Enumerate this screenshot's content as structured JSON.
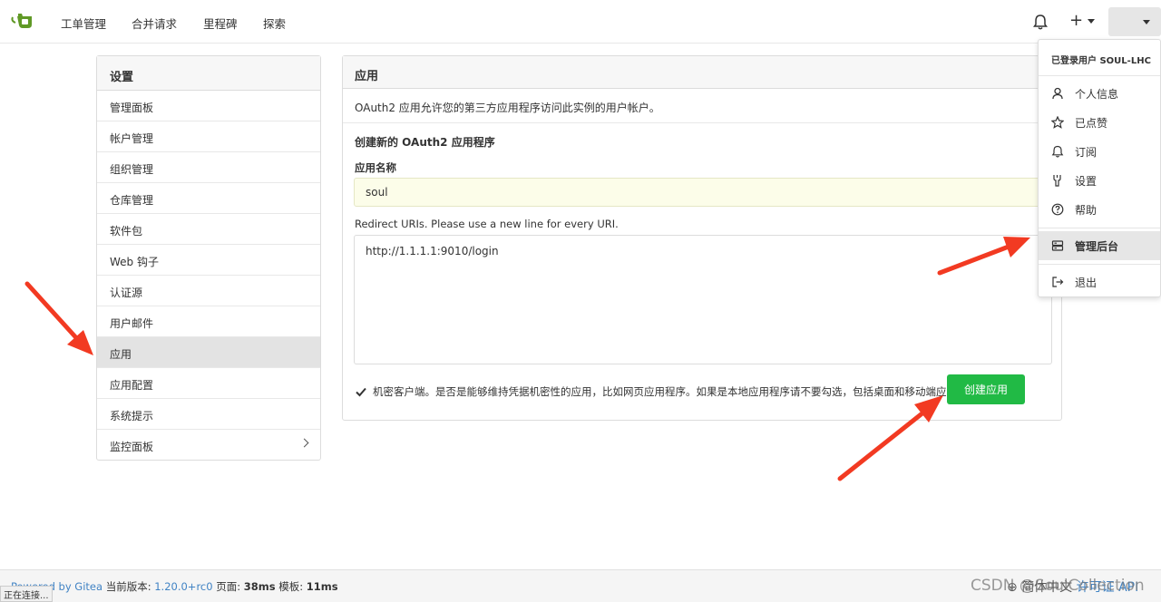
{
  "nav": {
    "items": [
      {
        "label": "工单管理"
      },
      {
        "label": "合并请求"
      },
      {
        "label": "里程碑"
      },
      {
        "label": "探索"
      }
    ]
  },
  "sidebar": {
    "title": "设置",
    "items": [
      {
        "label": "管理面板"
      },
      {
        "label": "帐户管理"
      },
      {
        "label": "组织管理"
      },
      {
        "label": "仓库管理"
      },
      {
        "label": "软件包"
      },
      {
        "label": "Web 钩子"
      },
      {
        "label": "认证源"
      },
      {
        "label": "用户邮件"
      },
      {
        "label": "应用"
      },
      {
        "label": "应用配置"
      },
      {
        "label": "系统提示"
      },
      {
        "label": "监控面板"
      }
    ],
    "active_index": 8
  },
  "panel": {
    "title": "应用",
    "description": "OAuth2 应用允许您的第三方应用程序访问此实例的用户帐户。",
    "section_title": "创建新的 OAuth2 应用程序",
    "name_label": "应用名称",
    "name_value": "soul",
    "uri_label": "Redirect URIs. Please use a new line for every URI.",
    "uri_value": "http://1.1.1.1:9010/login",
    "confidential_label": "机密客户端。是否是能够维持凭据机密性的应用，比如网页应用程序。如果是本地应用程序请不要勾选，包括桌面和移动端应用。",
    "create_button": "创建应用"
  },
  "dropdown": {
    "header": "已登录用户 SOUL-LHC",
    "items": [
      {
        "label": "个人信息",
        "icon": "person-icon"
      },
      {
        "label": "已点赞",
        "icon": "star-icon"
      },
      {
        "label": "订阅",
        "icon": "bell-icon"
      },
      {
        "label": "设置",
        "icon": "tools-icon"
      },
      {
        "label": "帮助",
        "icon": "question-icon"
      },
      {
        "label": "管理后台",
        "icon": "server-icon"
      },
      {
        "label": "退出",
        "icon": "sign-out-icon"
      }
    ],
    "active_index": 5
  },
  "footer": {
    "powered": "Powered by Gitea",
    "version_label": "当前版本:",
    "version": "1.20.0+rc0",
    "page_label": "页面:",
    "page_time": "38ms",
    "template_label": "模板:",
    "template_time": "11ms",
    "language": "简体中文",
    "licenses": "许可证",
    "api": "API"
  },
  "status_bar": "正在连接...",
  "watermark": "CSDN @SoulCollection",
  "colors": {
    "accent_green": "#21ba45",
    "link_blue": "#4183c4",
    "arrow_red": "#f23a22"
  }
}
